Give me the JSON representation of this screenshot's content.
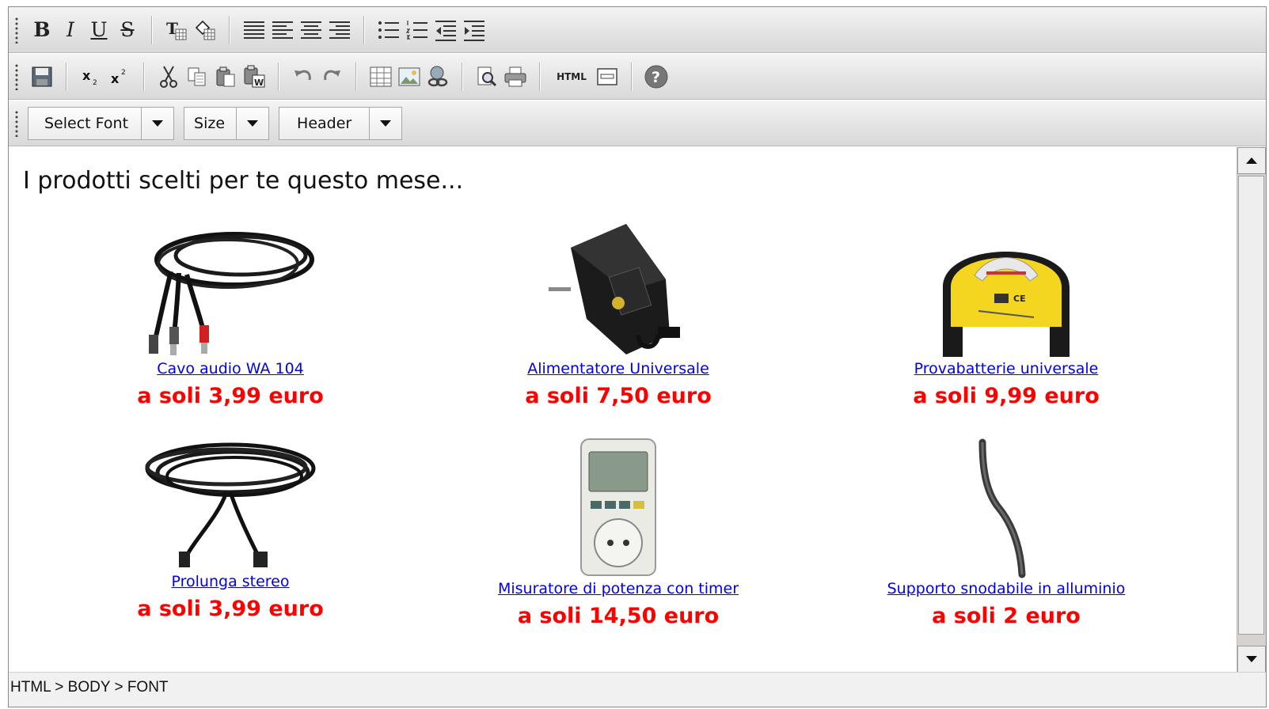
{
  "toolbar1": {
    "bold": "B",
    "italic": "I",
    "underline": "U",
    "strike": "S"
  },
  "toolbar2": {
    "html_label": "HTML"
  },
  "toolbar3": {
    "font_select": "Select Font",
    "size_select": "Size",
    "header_select": "Header"
  },
  "content": {
    "headline": "I prodotti scelti per te questo mese...",
    "products": [
      {
        "name": "Cavo audio WA 104",
        "price": "a soli 3,99 euro"
      },
      {
        "name": "Alimentatore Universale",
        "price": "a soli 7,50 euro"
      },
      {
        "name": "Provabatterie universale",
        "price": "a soli 9,99 euro"
      },
      {
        "name": "Prolunga stereo",
        "price": "a soli 3,99 euro"
      },
      {
        "name": "Misuratore di potenza con timer",
        "price": "a soli 14,50 euro"
      },
      {
        "name": "Supporto snodabile in alluminio",
        "price": "a soli 2 euro"
      }
    ]
  },
  "status": {
    "path": "HTML > BODY > FONT"
  },
  "colors": {
    "link": "#0000ee",
    "price": "#ff0000"
  }
}
